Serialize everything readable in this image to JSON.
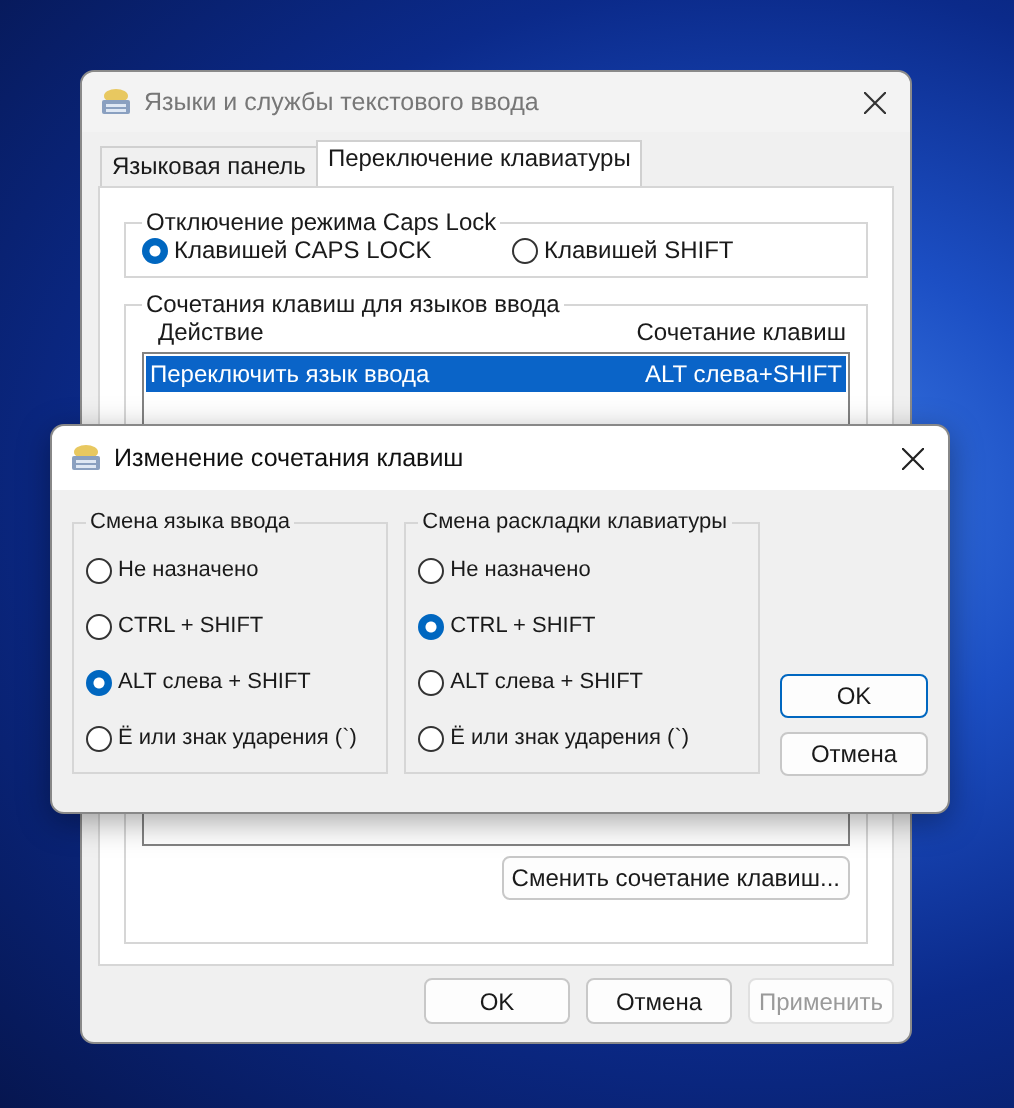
{
  "main_window": {
    "title": "Языки и службы текстового ввода",
    "tabs": [
      {
        "label": "Языковая панель",
        "selected": false
      },
      {
        "label": "Переключение клавиатуры",
        "selected": true
      }
    ],
    "caps_lock_group": {
      "title": "Отключение режима Caps Lock",
      "options": [
        {
          "label": "Клавишей CAPS LOCK",
          "selected": true
        },
        {
          "label": "Клавишей SHIFT",
          "selected": false
        }
      ]
    },
    "hotkeys_group": {
      "title": "Сочетания клавиш для языков ввода",
      "columns": [
        "Действие",
        "Сочетание клавиш"
      ],
      "rows": [
        {
          "action": "Переключить язык ввода",
          "keys": "ALT слева+SHIFT",
          "selected": true
        }
      ],
      "change_button": "Сменить сочетание клавиш..."
    },
    "buttons": [
      {
        "label": "OK",
        "disabled": false
      },
      {
        "label": "Отмена",
        "disabled": false
      },
      {
        "label": "Применить",
        "disabled": true
      }
    ]
  },
  "dialog": {
    "title": "Изменение сочетания клавиш",
    "groups": [
      {
        "title": "Смена языка ввода",
        "options": [
          {
            "label": "Не назначено",
            "selected": false
          },
          {
            "label": "CTRL + SHIFT",
            "selected": false
          },
          {
            "label": "ALT слева + SHIFT",
            "selected": true
          },
          {
            "label": "Ё или знак ударения (`)",
            "selected": false
          }
        ]
      },
      {
        "title": "Смена раскладки клавиатуры",
        "options": [
          {
            "label": "Не назначено",
            "selected": false
          },
          {
            "label": "CTRL + SHIFT",
            "selected": true
          },
          {
            "label": "ALT слева + SHIFT",
            "selected": false
          },
          {
            "label": "Ё или знак ударения (`)",
            "selected": false
          }
        ]
      }
    ],
    "buttons": [
      {
        "label": "OK",
        "default": true
      },
      {
        "label": "Отмена",
        "default": false
      }
    ]
  }
}
